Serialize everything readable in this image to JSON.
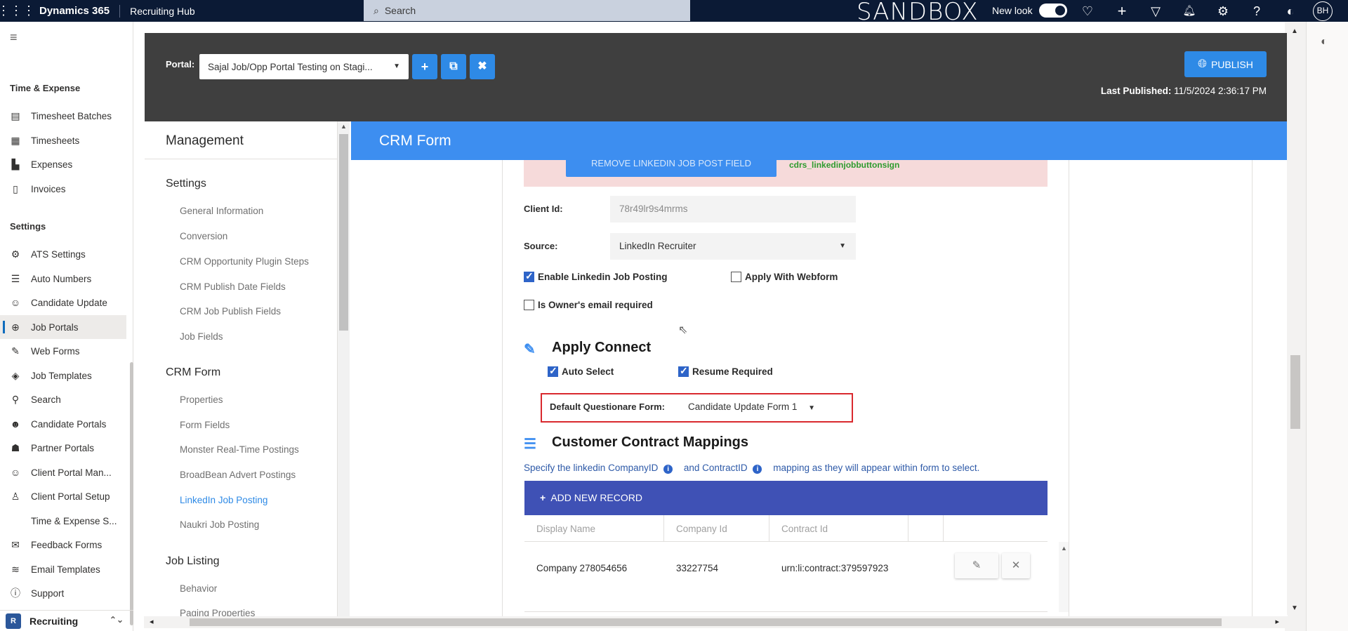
{
  "topbar": {
    "app_name": "Dynamics 365",
    "module": "Recruiting Hub",
    "search_placeholder": "Search",
    "environment": "SANDBOX",
    "new_look_label": "New look",
    "avatar_initials": "BH"
  },
  "leftnav": {
    "groups": {
      "time_expense": "Time & Expense",
      "settings": "Settings"
    },
    "time_items": [
      "Timesheet Batches",
      "Timesheets",
      "Expenses",
      "Invoices"
    ],
    "settings_items": [
      "ATS Settings",
      "Auto Numbers",
      "Candidate Update",
      "Job Portals",
      "Web Forms",
      "Job Templates",
      "Search",
      "Candidate Portals",
      "Partner Portals",
      "Client Portal Man...",
      "Client Portal Setup",
      "Time & Expense S...",
      "Feedback Forms",
      "Email Templates",
      "Support"
    ],
    "active_item": "Job Portals",
    "area": {
      "badge": "R",
      "label": "Recruiting"
    }
  },
  "portal_header": {
    "portal_label": "Portal:",
    "portal_value": "Sajal Job/Opp Portal Testing on Stagi...",
    "publish_label": "PUBLISH",
    "last_published_label": "Last Published:",
    "last_published_value": "11/5/2024 2:36:17 PM"
  },
  "management": {
    "title": "Management",
    "sections": [
      {
        "title": "Settings",
        "items": [
          "General Information",
          "Conversion",
          "CRM Opportunity Plugin Steps",
          "CRM Publish Date Fields",
          "CRM Job Publish Fields",
          "Job Fields"
        ]
      },
      {
        "title": "CRM Form",
        "items": [
          "Properties",
          "Form Fields",
          "Monster Real-Time Postings",
          "BroadBean Advert Postings",
          "LinkedIn Job Posting",
          "Naukri Job Posting"
        ]
      },
      {
        "title": "Job Listing",
        "items": [
          "Behavior",
          "Paging Properties"
        ]
      }
    ],
    "active_item": "LinkedIn Job Posting"
  },
  "crm_form": {
    "title": "CRM Form",
    "remove_button": "REMOVE LINKEDIN JOB POST FIELD",
    "green_field_text": "cdrs_linkedinjobbuttonsign",
    "client_id_label": "Client Id:",
    "client_id_value": "78r49lr9s4mrms",
    "source_label": "Source:",
    "source_value": "LinkedIn Recruiter",
    "enable_linkedin_label": "Enable Linkedin Job Posting",
    "enable_linkedin_checked": true,
    "apply_webform_label": "Apply With Webform",
    "apply_webform_checked": false,
    "owner_email_label": "Is Owner's email required",
    "owner_email_checked": false,
    "apply_connect": {
      "title": "Apply Connect",
      "auto_select_label": "Auto Select",
      "auto_select_checked": true,
      "resume_required_label": "Resume Required",
      "resume_required_checked": true,
      "default_form_label": "Default Questionare Form:",
      "default_form_value": "Candidate Update Form 1"
    },
    "contract_mappings": {
      "title": "Customer Contract Mappings",
      "hint_part1": "Specify the linkedin CompanyID",
      "hint_part2": "and ContractID",
      "hint_part3": "mapping as they will appear within form to select.",
      "add_label": "ADD NEW RECORD",
      "columns": [
        "Display Name",
        "Company Id",
        "Contract Id"
      ],
      "rows": [
        {
          "display_name": "Company 278054656",
          "company_id": "33227754",
          "contract_id": "urn:li:contract:379597923"
        }
      ]
    }
  }
}
